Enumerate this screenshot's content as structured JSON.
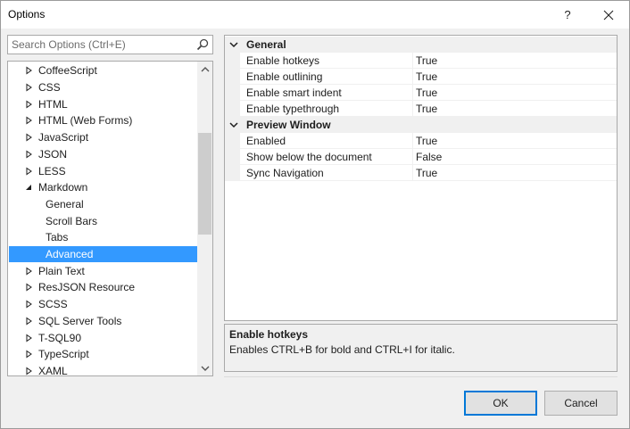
{
  "window": {
    "title": "Options",
    "help_label": "?",
    "close_icon": "close-icon"
  },
  "search": {
    "placeholder": "Search Options (Ctrl+E)",
    "value": "",
    "icon": "search-icon"
  },
  "tree": {
    "items": [
      {
        "label": "CoffeeScript",
        "level": 0,
        "state": "collapsed"
      },
      {
        "label": "CSS",
        "level": 0,
        "state": "collapsed"
      },
      {
        "label": "HTML",
        "level": 0,
        "state": "collapsed"
      },
      {
        "label": "HTML (Web Forms)",
        "level": 0,
        "state": "collapsed"
      },
      {
        "label": "JavaScript",
        "level": 0,
        "state": "collapsed"
      },
      {
        "label": "JSON",
        "level": 0,
        "state": "collapsed"
      },
      {
        "label": "LESS",
        "level": 0,
        "state": "collapsed"
      },
      {
        "label": "Markdown",
        "level": 0,
        "state": "expanded"
      },
      {
        "label": "General",
        "level": 1,
        "state": "leaf"
      },
      {
        "label": "Scroll Bars",
        "level": 1,
        "state": "leaf"
      },
      {
        "label": "Tabs",
        "level": 1,
        "state": "leaf"
      },
      {
        "label": "Advanced",
        "level": 1,
        "state": "leaf",
        "selected": true
      },
      {
        "label": "Plain Text",
        "level": 0,
        "state": "collapsed"
      },
      {
        "label": "ResJSON Resource",
        "level": 0,
        "state": "collapsed"
      },
      {
        "label": "SCSS",
        "level": 0,
        "state": "collapsed"
      },
      {
        "label": "SQL Server Tools",
        "level": 0,
        "state": "collapsed"
      },
      {
        "label": "T-SQL90",
        "level": 0,
        "state": "collapsed"
      },
      {
        "label": "TypeScript",
        "level": 0,
        "state": "collapsed"
      },
      {
        "label": "XAML",
        "level": 0,
        "state": "collapsed"
      }
    ]
  },
  "grid": {
    "categories": [
      {
        "name": "General",
        "properties": [
          {
            "name": "Enable hotkeys",
            "value": "True"
          },
          {
            "name": "Enable outlining",
            "value": "True"
          },
          {
            "name": "Enable smart indent",
            "value": "True"
          },
          {
            "name": "Enable typethrough",
            "value": "True"
          }
        ]
      },
      {
        "name": "Preview Window",
        "properties": [
          {
            "name": "Enabled",
            "value": "True"
          },
          {
            "name": "Show below the document",
            "value": "False"
          },
          {
            "name": "Sync Navigation",
            "value": "True"
          }
        ]
      }
    ]
  },
  "description": {
    "title": "Enable hotkeys",
    "text": "Enables CTRL+B for bold and CTRL+I for italic."
  },
  "buttons": {
    "ok": "OK",
    "cancel": "Cancel"
  },
  "colors": {
    "selection": "#3399ff",
    "accent_border": "#0078d7"
  }
}
